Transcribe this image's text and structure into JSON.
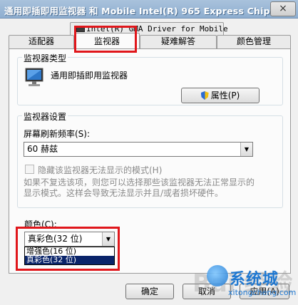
{
  "window": {
    "title": "通用即插即用监视器 和 Mobile Intel(R) 965 Express Chip...",
    "close_symbol": "×"
  },
  "tabs": {
    "back_row": [
      "Intel(R) GMA Driver for Mobile"
    ],
    "front_row": [
      "适配器",
      "监视器",
      "疑难解答",
      "颜色管理"
    ],
    "selected": "监视器"
  },
  "monitor_type": {
    "legend": "监视器类型",
    "name": "通用即插即用监视器",
    "properties_button": "属性(P)"
  },
  "monitor_settings": {
    "legend": "监视器设置",
    "refresh_label": "屏幕刷新频率(S):",
    "refresh_value": "60 赫兹",
    "hide_modes_label": "隐藏该监视器无法显示的模式(H)",
    "help_line1": "如果不复选该项，则您可以选择那些该监视器无法正常显示的",
    "help_line2": "显示模式。这样会导致无法显示并且/或者损坏硬件。"
  },
  "colors": {
    "label": "颜色(C):",
    "selected": "真彩色(32 位)",
    "options": [
      "增强色(16 位)",
      "真彩色(32 位)"
    ]
  },
  "buttons": {
    "ok": "确定",
    "cancel": "取消",
    "apply": "应用(A)"
  },
  "watermark": {
    "baidu": "Bai 经验",
    "brand": "系统城",
    "url": "xitongcheng.com"
  },
  "colors_theme": {
    "highlight": "#0a246a",
    "annotation_red": "#e0161b",
    "brand_blue": "#1f78d1"
  }
}
